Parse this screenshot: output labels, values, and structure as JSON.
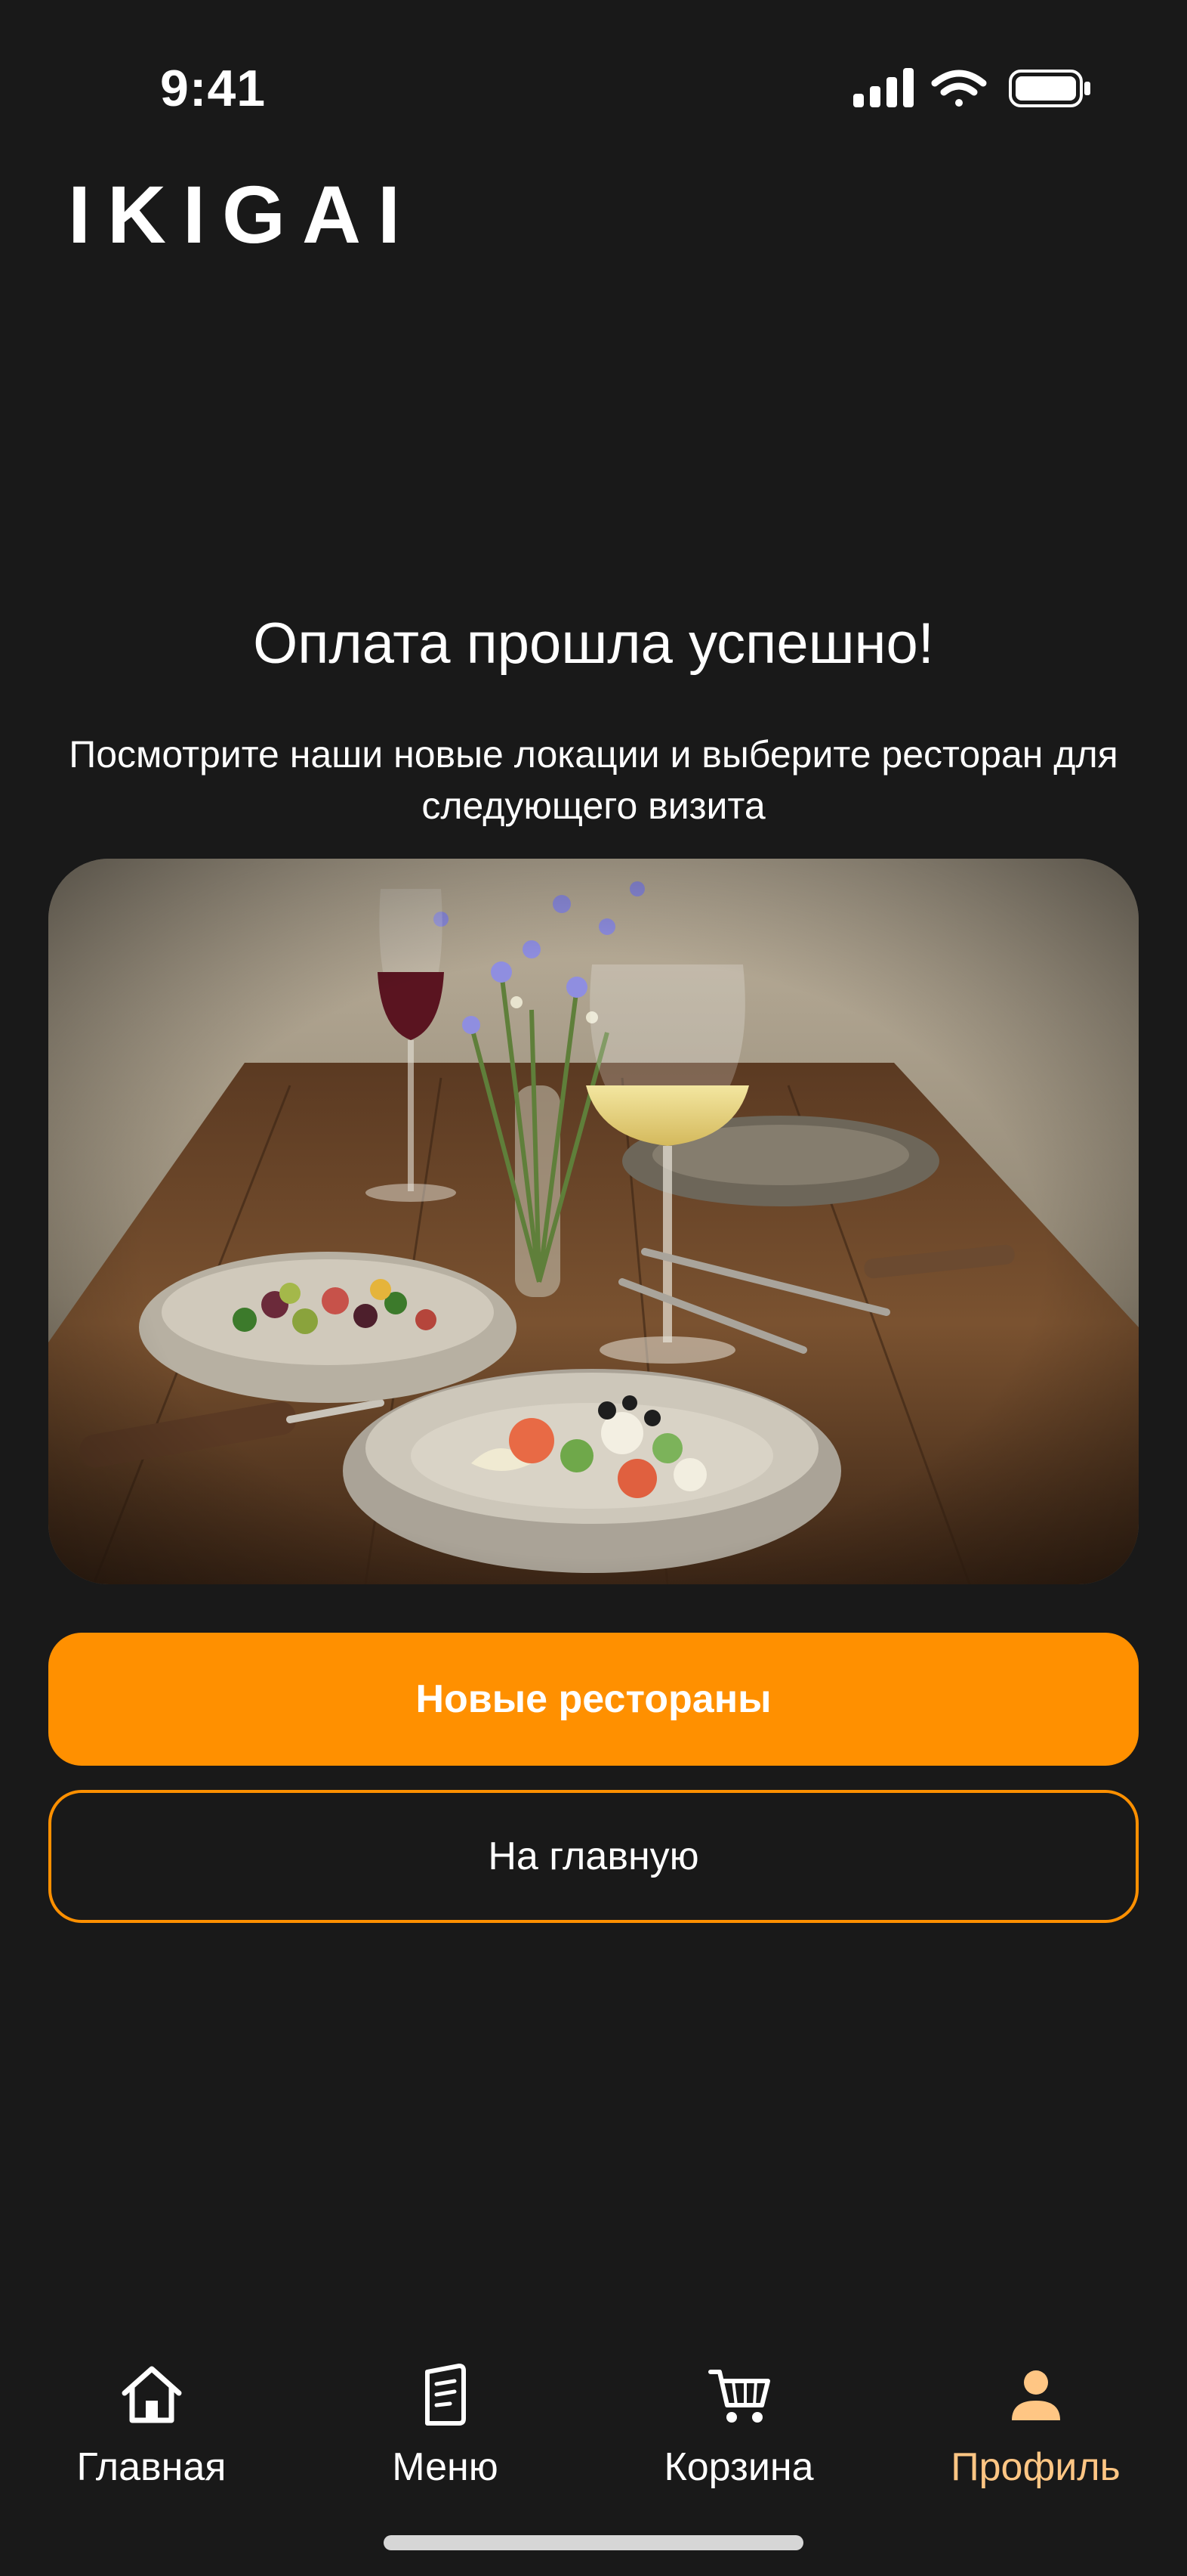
{
  "status_bar": {
    "time": "9:41"
  },
  "header": {
    "logo": "IKIGAI"
  },
  "main": {
    "title": "Оплата прошла успешно!",
    "subtitle": "Посмотрите наши новые локации и выберите ресторан для следующего визита",
    "primary_button": "Новые рестораны",
    "secondary_button": "На главную"
  },
  "tabbar": {
    "items": [
      {
        "label": "Главная",
        "icon": "home-icon",
        "active": false
      },
      {
        "label": "Меню",
        "icon": "menu-book-icon",
        "active": false
      },
      {
        "label": "Корзина",
        "icon": "cart-icon",
        "active": false
      },
      {
        "label": "Профиль",
        "icon": "profile-icon",
        "active": true
      }
    ]
  },
  "colors": {
    "background": "#191919",
    "accent": "#ff9000",
    "active_tab": "#ffc684",
    "text": "#ffffff"
  }
}
